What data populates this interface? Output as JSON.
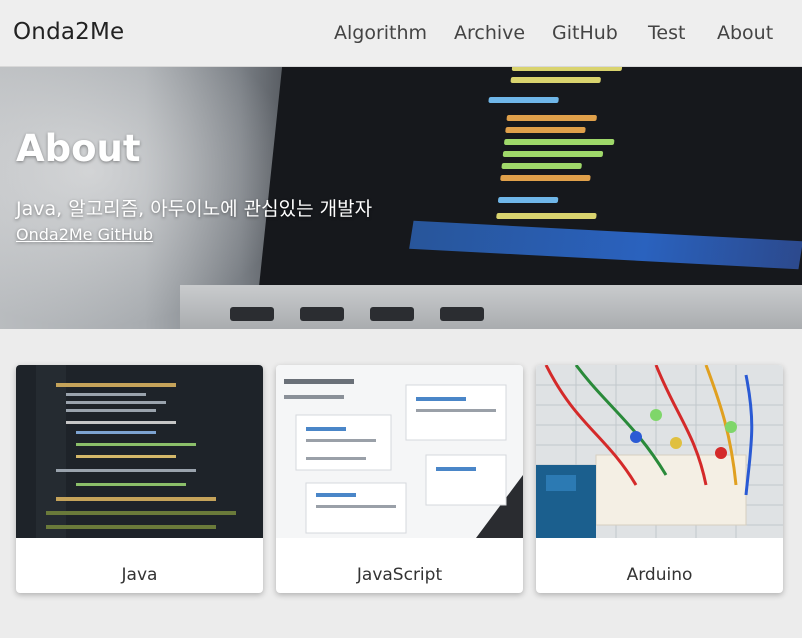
{
  "navbar": {
    "brand": "Onda2Me",
    "items": [
      {
        "label": "Algorithm"
      },
      {
        "label": "Archive"
      },
      {
        "label": "GitHub"
      },
      {
        "label": "Test"
      },
      {
        "label": "About"
      }
    ]
  },
  "hero": {
    "title": "About",
    "subtitle": "Java, 알고리즘, 아두이노에 관심있는 개발자",
    "link": "Onda2Me GitHub"
  },
  "cards": [
    {
      "label": "Java",
      "image": "code-editor-photo"
    },
    {
      "label": "JavaScript",
      "image": "github-repositories-photo"
    },
    {
      "label": "Arduino",
      "image": "arduino-breadboard-photo"
    }
  ],
  "colors": {
    "navbar_bg": "#eeeeee",
    "page_bg": "#ececec",
    "card_bg": "#ffffff"
  }
}
